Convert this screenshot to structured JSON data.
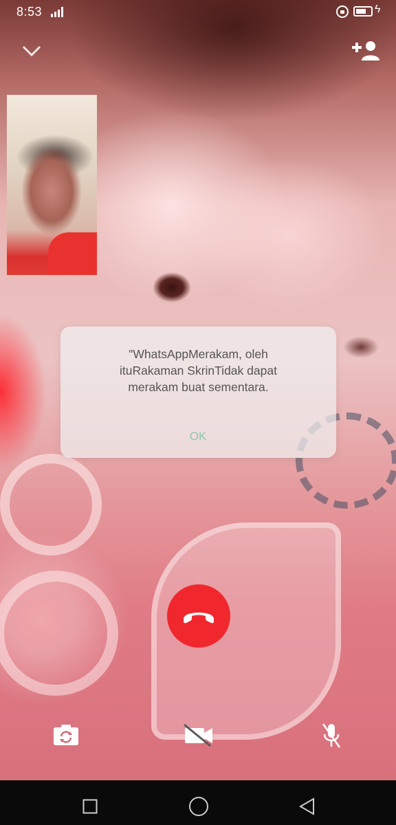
{
  "status_bar": {
    "time": "8:53"
  },
  "dialog": {
    "message": "\"WhatsAppMerakam, oleh\nituRakaman SkrinTidak dapat\nmerakam buat sementara.",
    "ok_label": "OK"
  },
  "icons": {
    "collapse": "chevron-down-icon",
    "add_participant": "add-person-icon",
    "end_call": "phone-hangup-icon",
    "switch_camera": "camera-switch-icon",
    "video_off": "video-off-icon",
    "mic_off": "mic-off-icon",
    "nav_recent": "square-icon",
    "nav_home": "circle-icon",
    "nav_back": "triangle-back-icon"
  },
  "colors": {
    "end_call": "#f0282e",
    "ok_text": "#8fc7b2",
    "nav_bar": "#0a0a0a"
  }
}
